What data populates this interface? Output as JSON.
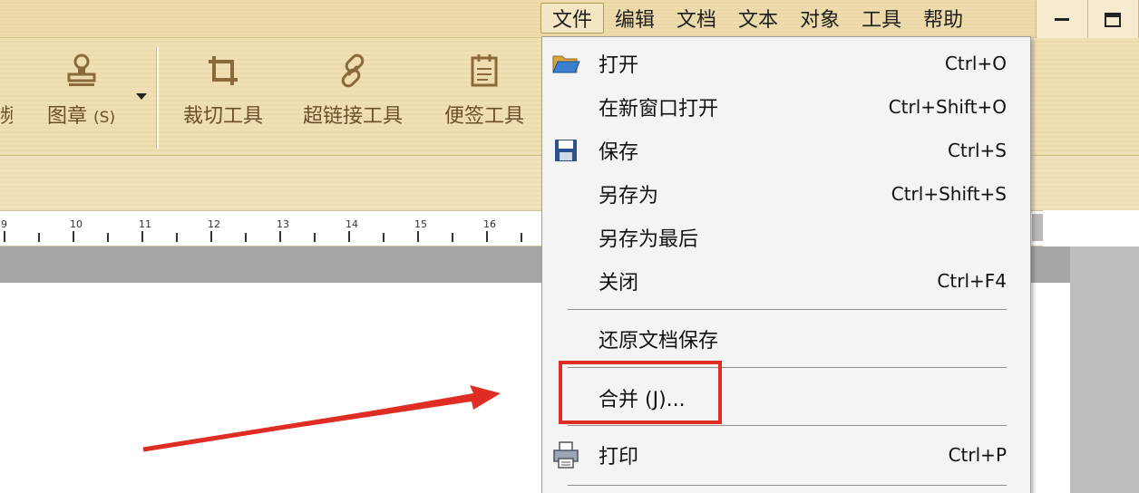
{
  "menubar": {
    "items": [
      {
        "label": "文件",
        "active": true
      },
      {
        "label": "编辑",
        "active": false
      },
      {
        "label": "文档",
        "active": false
      },
      {
        "label": "文本",
        "active": false
      },
      {
        "label": "对象",
        "active": false
      },
      {
        "label": "工具",
        "active": false
      },
      {
        "label": "帮助",
        "active": false
      }
    ]
  },
  "toolbar": {
    "partial_label": "频",
    "stamp_label": "图章",
    "stamp_shortcut": "(S)",
    "crop_label": "裁切工具",
    "hyperlink_label": "超链接工具",
    "note_label": "便签工具"
  },
  "ruler": {
    "numbers": [
      "9",
      "10",
      "11",
      "12",
      "13",
      "14",
      "15",
      "16"
    ]
  },
  "file_menu": {
    "items": [
      {
        "label": "打开",
        "shortcut": "Ctrl+O",
        "icon": "folder-open-icon"
      },
      {
        "label": "在新窗口打开",
        "shortcut": "Ctrl+Shift+O",
        "icon": ""
      },
      {
        "label": "保存",
        "shortcut": "Ctrl+S",
        "icon": "save-icon"
      },
      {
        "label": "另存为",
        "shortcut": "Ctrl+Shift+S",
        "icon": ""
      },
      {
        "label": "另存为最后",
        "shortcut": "",
        "icon": ""
      },
      {
        "label": "关闭",
        "shortcut": "Ctrl+F4",
        "icon": ""
      },
      {
        "label": "还原文档保存",
        "shortcut": "",
        "icon": ""
      },
      {
        "label": "合并 (J)...",
        "shortcut": "",
        "icon": ""
      },
      {
        "label": "打印",
        "shortcut": "Ctrl+P",
        "icon": "printer-icon"
      }
    ]
  },
  "annotation": {
    "highlight_color": "#e02d24",
    "arrow_color": "#e02d24"
  },
  "colors": {
    "toolbar_bg": "#efdcae",
    "menu_bg": "#f4f4f4",
    "tool_brown": "#7a5a2e"
  }
}
